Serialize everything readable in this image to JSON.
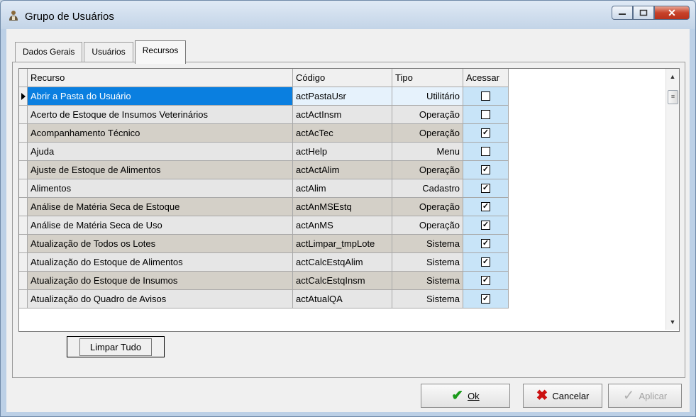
{
  "window": {
    "title": "Grupo de Usuários"
  },
  "tabs": [
    {
      "label": "Dados Gerais",
      "active": false
    },
    {
      "label": "Usuários",
      "active": false
    },
    {
      "label": "Recursos",
      "active": true
    }
  ],
  "grid": {
    "headers": {
      "recurso": "Recurso",
      "codigo": "Código",
      "tipo": "Tipo",
      "acessar": "Acessar"
    },
    "rows": [
      {
        "recurso": "Abrir a Pasta do Usuário",
        "codigo": "actPastaUsr",
        "tipo": "Utilitário",
        "acessar": false,
        "selected": true
      },
      {
        "recurso": "Acerto de Estoque de Insumos Veterinários",
        "codigo": "actActInsm",
        "tipo": "Operação",
        "acessar": false
      },
      {
        "recurso": "Acompanhamento Técnico",
        "codigo": "actAcTec",
        "tipo": "Operação",
        "acessar": true
      },
      {
        "recurso": "Ajuda",
        "codigo": "actHelp",
        "tipo": "Menu",
        "acessar": false
      },
      {
        "recurso": "Ajuste de Estoque de Alimentos",
        "codigo": "actActAlim",
        "tipo": "Operação",
        "acessar": true
      },
      {
        "recurso": "Alimentos",
        "codigo": "actAlim",
        "tipo": "Cadastro",
        "acessar": true
      },
      {
        "recurso": "Análise de Matéria Seca de Estoque",
        "codigo": "actAnMSEstq",
        "tipo": "Operação",
        "acessar": true
      },
      {
        "recurso": "Análise de Matéria Seca de Uso",
        "codigo": "actAnMS",
        "tipo": "Operação",
        "acessar": true
      },
      {
        "recurso": "Atualização de Todos os Lotes",
        "codigo": "actLimpar_tmpLote",
        "tipo": "Sistema",
        "acessar": true
      },
      {
        "recurso": "Atualização do Estoque de Alimentos",
        "codigo": "actCalcEstqAlim",
        "tipo": "Sistema",
        "acessar": true
      },
      {
        "recurso": "Atualização do Estoque de Insumos",
        "codigo": "actCalcEstqInsm",
        "tipo": "Sistema",
        "acessar": true
      },
      {
        "recurso": "Atualização do Quadro de Avisos",
        "codigo": "actAtualQA",
        "tipo": "Sistema",
        "acessar": true
      }
    ]
  },
  "buttons": {
    "limpar": "Limpar Tudo",
    "ok": "Ok",
    "cancelar": "Cancelar",
    "aplicar": "Aplicar"
  },
  "colors": {
    "selection": "#0a7fe0",
    "ok_icon": "#1a9a1a",
    "cancel_icon": "#cc1111"
  }
}
